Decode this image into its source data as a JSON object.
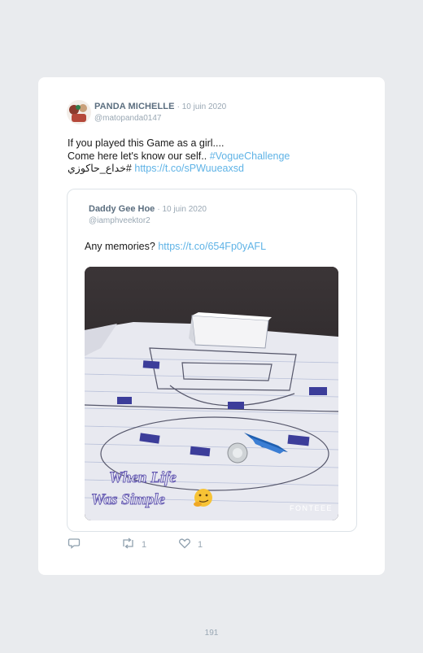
{
  "tweet": {
    "author_name": "PANDA MICHELLE",
    "date": "· 10 juin 2020",
    "handle": "@matopanda0147",
    "line1": "If you played this Game as a girl....",
    "line2_text": "Come here let's know our self.. ",
    "line2_hashtag": "#VogueChallenge",
    "line3_hashtag": "#خداع_حاكوزي",
    "line3_link": "https://t.co/sPWuueaxsd"
  },
  "quoted": {
    "author_name": "Daddy Gee Hoe",
    "date": "· 10 juin 2020",
    "handle": "@iamphveektor2",
    "text": "Any memories? ",
    "link": "https://t.co/654Fp0yAFL",
    "media": {
      "caption_line1": "When Life",
      "caption_line2": "Was Simple",
      "watermark": "FONTEEE"
    }
  },
  "actions": {
    "reply_count": "",
    "retweet_count": "1",
    "like_count": "1"
  },
  "page_number": "191"
}
